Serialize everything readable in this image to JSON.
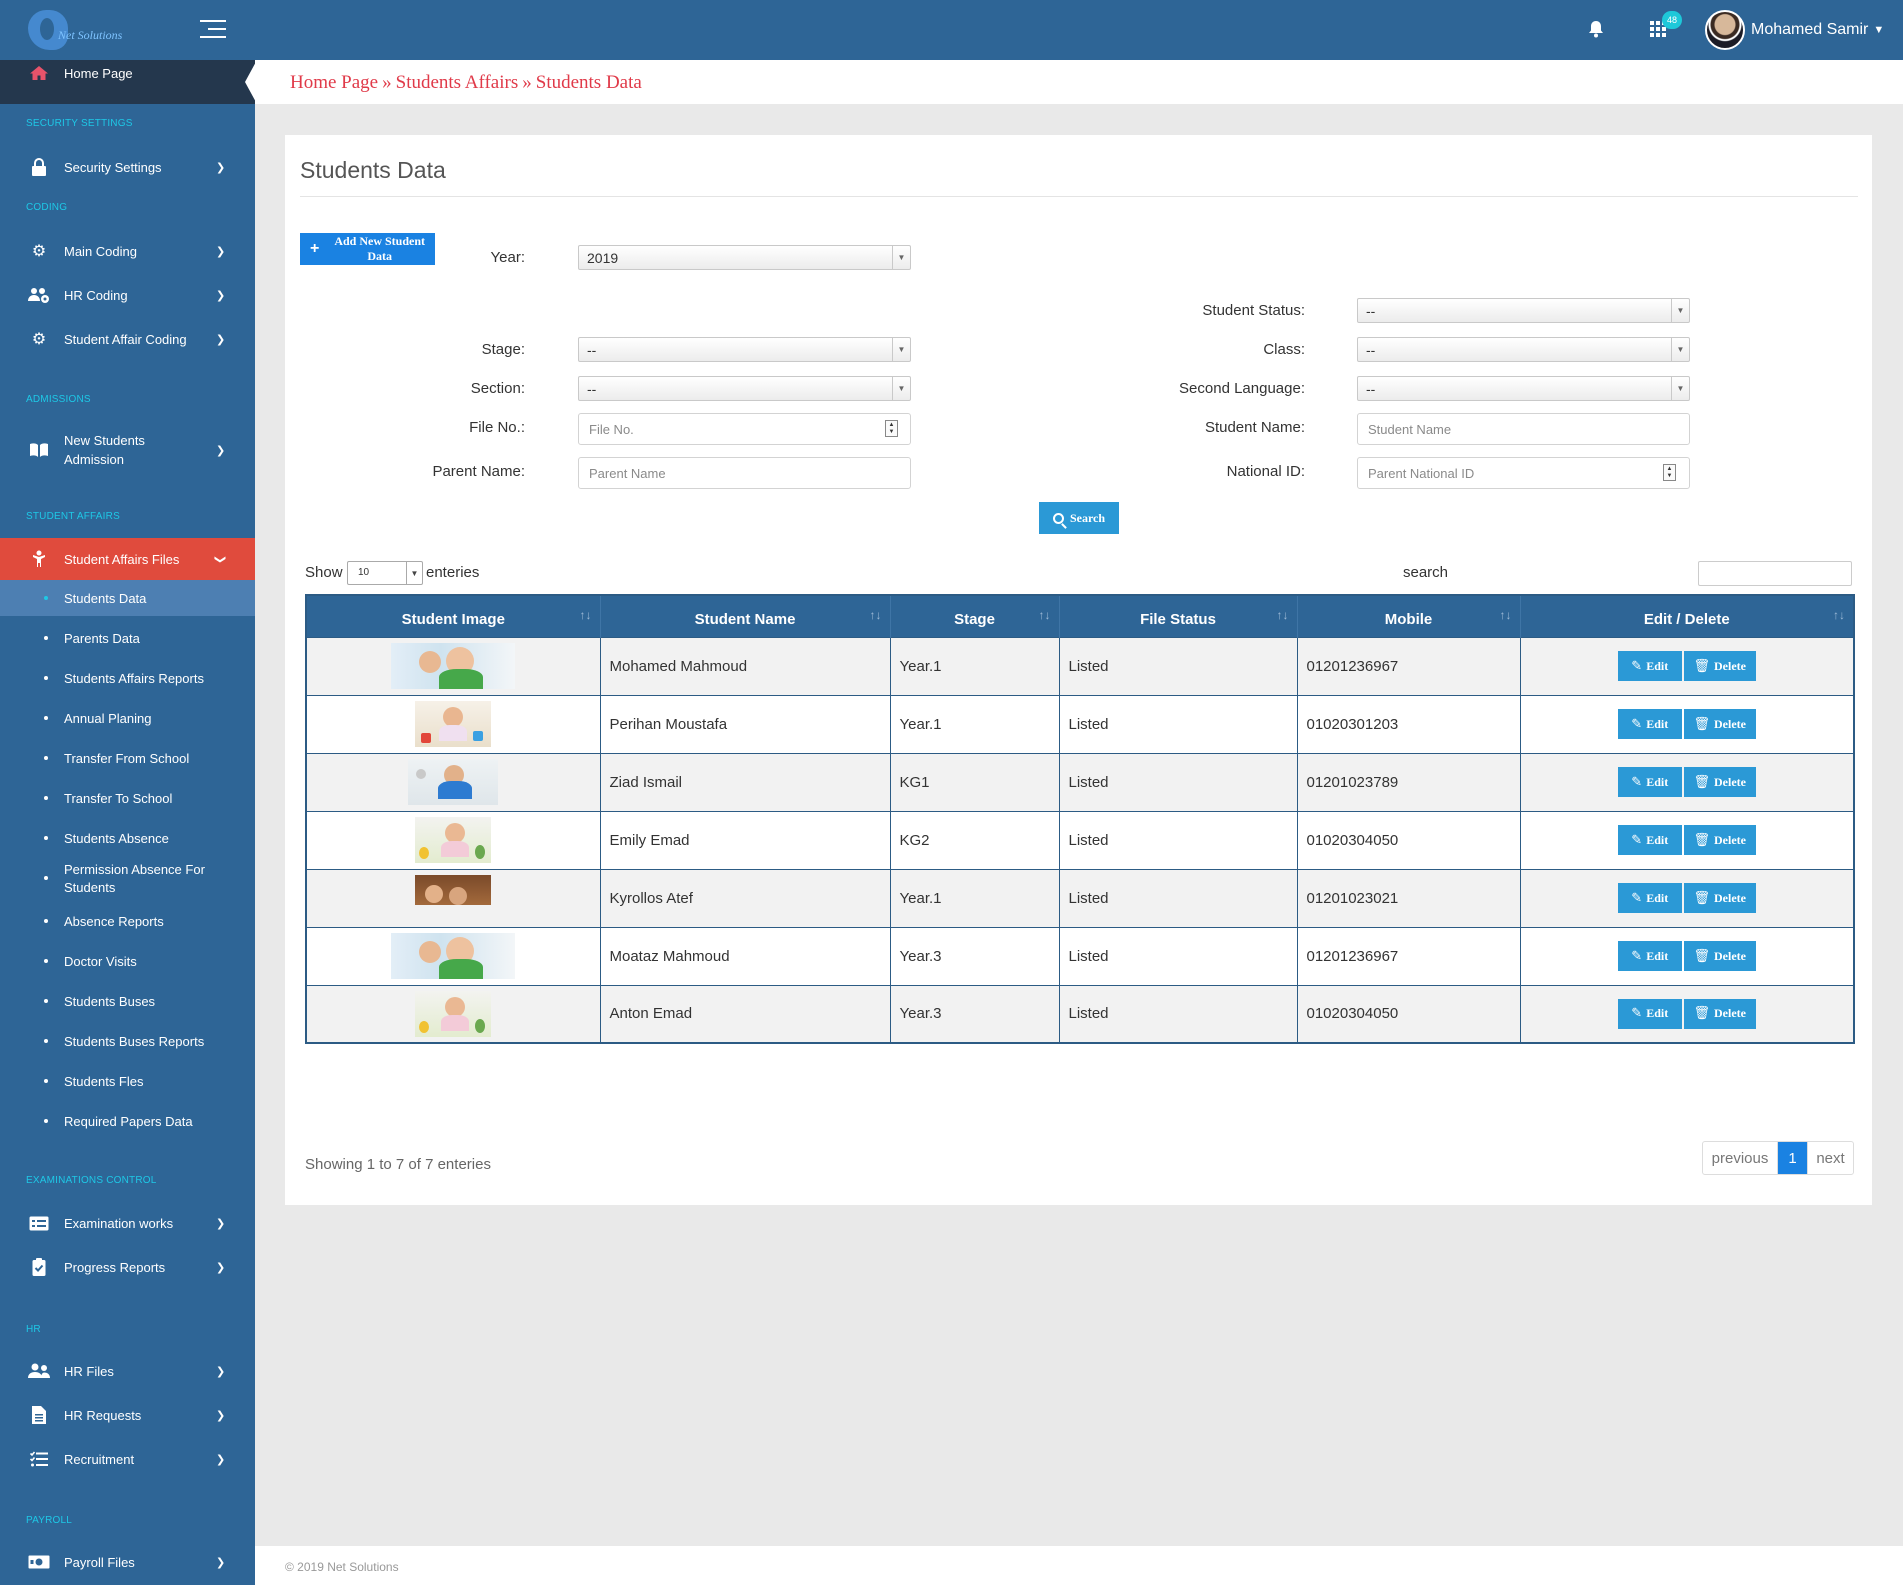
{
  "header": {
    "logo_text": "Net Solutions",
    "notification_badge": "48",
    "user_name": "Mohamed Samir"
  },
  "sidebar": {
    "home": "Home Page",
    "sections": {
      "security": "SECURITY SETTINGS",
      "coding": "CODING",
      "admissions": "ADMISSIONS",
      "student_affairs": "STUDENT AFFAIRS",
      "examinations": "EXAMINATIONS CONTROL",
      "hr": "HR",
      "payroll": "PAYROLL"
    },
    "items": {
      "security_settings": "Security Settings",
      "main_coding": "Main Coding",
      "hr_coding": "HR Coding",
      "student_affair_coding": "Student Affair Coding",
      "new_students_admission": "New Students Admission",
      "student_affairs_files": "Student Affairs Files",
      "examination_works": "Examination works",
      "progress_reports": "Progress Reports",
      "hr_files": "HR Files",
      "hr_requests": "HR Requests",
      "recruitment": "Recruitment",
      "payroll_files": "Payroll Files"
    },
    "sub_items": [
      "Students Data",
      "Parents Data",
      "Students Affairs Reports",
      "Annual Planing",
      "Transfer From School",
      "Transfer To School",
      "Students Absence",
      "Permission Absence For Students",
      "Absence Reports",
      "Doctor Visits",
      "Students Buses",
      "Students Buses Reports",
      "Students Fles",
      "Required Papers Data"
    ]
  },
  "breadcrumb": {
    "items": [
      "Home Page",
      "Students Affairs",
      "Students Data"
    ],
    "separator": "»"
  },
  "main": {
    "title": "Students Data",
    "add_button": "Add New Student Data",
    "filters": {
      "year": {
        "label": "Year:",
        "value": "2019"
      },
      "stage": {
        "label": "Stage:",
        "value": "--"
      },
      "section": {
        "label": "Section:",
        "value": "--"
      },
      "file_no": {
        "label": "File No.:",
        "placeholder": "File No."
      },
      "parent_name": {
        "label": "Parent Name:",
        "placeholder": "Parent Name"
      },
      "student_status": {
        "label": "Student Status:",
        "value": "--"
      },
      "class": {
        "label": "Class:",
        "value": "--"
      },
      "second_language": {
        "label": "Second Language:",
        "value": "--"
      },
      "student_name": {
        "label": "Student Name:",
        "placeholder": "Student Name"
      },
      "national_id": {
        "label": "National ID:",
        "placeholder": "Parent National ID"
      }
    },
    "search_button": "Search",
    "table_controls": {
      "show_label": "Show",
      "page_length": "10",
      "entries_label": "enteries",
      "search_label": "search"
    },
    "table": {
      "columns": [
        "Student Image",
        "Student Name",
        "Stage",
        "File Status",
        "Mobile",
        "Edit / Delete"
      ],
      "edit_label": "Edit",
      "delete_label": "Delete",
      "rows": [
        {
          "name": "Mohamed Mahmoud",
          "stage": "Year.1",
          "status": "Listed",
          "mobile": "01201236967"
        },
        {
          "name": "Perihan Moustafa",
          "stage": "Year.1",
          "status": "Listed",
          "mobile": "01020301203"
        },
        {
          "name": "Ziad Ismail",
          "stage": "KG1",
          "status": "Listed",
          "mobile": "01201023789"
        },
        {
          "name": "Emily Emad",
          "stage": "KG2",
          "status": "Listed",
          "mobile": "01020304050"
        },
        {
          "name": "Kyrollos Atef",
          "stage": "Year.1",
          "status": "Listed",
          "mobile": "01201023021"
        },
        {
          "name": "Moataz Mahmoud",
          "stage": "Year.3",
          "status": "Listed",
          "mobile": "01201236967"
        },
        {
          "name": "Anton Emad",
          "stage": "Year.3",
          "status": "Listed",
          "mobile": "01020304050"
        }
      ]
    },
    "showing_text": "Showing 1 to 7 of 7 enteries",
    "pagination": {
      "previous": "previous",
      "current": "1",
      "next": "next"
    }
  },
  "footer": {
    "text": "© 2019 Net Solutions"
  },
  "colors": {
    "primary": "#2e6596",
    "active_menu": "#e04b3d",
    "accent_button": "#2b99d6",
    "breadcrumb": "#e03a49"
  }
}
